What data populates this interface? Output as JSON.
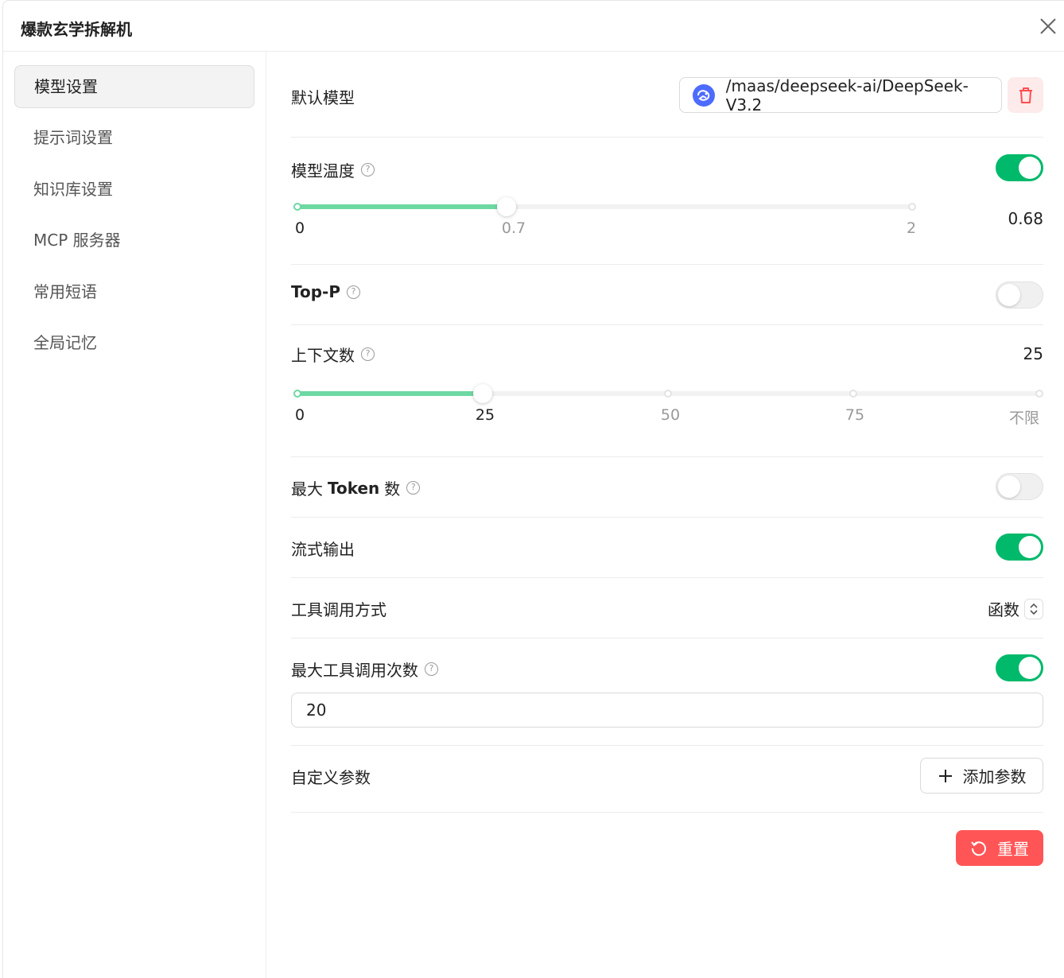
{
  "window": {
    "title": "爆款玄学拆解机"
  },
  "sidebar": {
    "items": [
      {
        "label": "模型设置",
        "active": true
      },
      {
        "label": "提示词设置"
      },
      {
        "label": "知识库设置"
      },
      {
        "label": "MCP 服务器"
      },
      {
        "label": "常用短语"
      },
      {
        "label": "全局记忆"
      }
    ]
  },
  "settings": {
    "default_model": {
      "label": "默认模型",
      "value": "/maas/deepseek-ai/DeepSeek-V3.2",
      "icon": "deepseek-logo-icon"
    },
    "temperature": {
      "label": "模型温度",
      "enabled": true,
      "value": "0.68",
      "marks": [
        "0",
        "0.7",
        "2"
      ],
      "min": 0,
      "max": 2,
      "current": 0.68
    },
    "top_p": {
      "label": "Top-P",
      "enabled": false
    },
    "context_count": {
      "label": "上下文数",
      "value": "25",
      "marks": [
        "0",
        "25",
        "50",
        "75",
        "不限"
      ],
      "current_fraction": 0.25
    },
    "max_tokens": {
      "label_prefix": "最大",
      "label_bold": "Token",
      "label_suffix": "数",
      "enabled": false
    },
    "stream_output": {
      "label": "流式输出",
      "enabled": true
    },
    "tool_call_mode": {
      "label": "工具调用方式",
      "value": "函数"
    },
    "max_tool_calls": {
      "label": "最大工具调用次数",
      "enabled": true,
      "value": "20"
    },
    "custom_params": {
      "label": "自定义参数",
      "add_label": "添加参数"
    },
    "reset_label": "重置"
  },
  "colors": {
    "accent": "#00b96b",
    "slider": "#6ed8a3",
    "danger": "#ff5556",
    "danger_bg": "#fdeaea"
  }
}
